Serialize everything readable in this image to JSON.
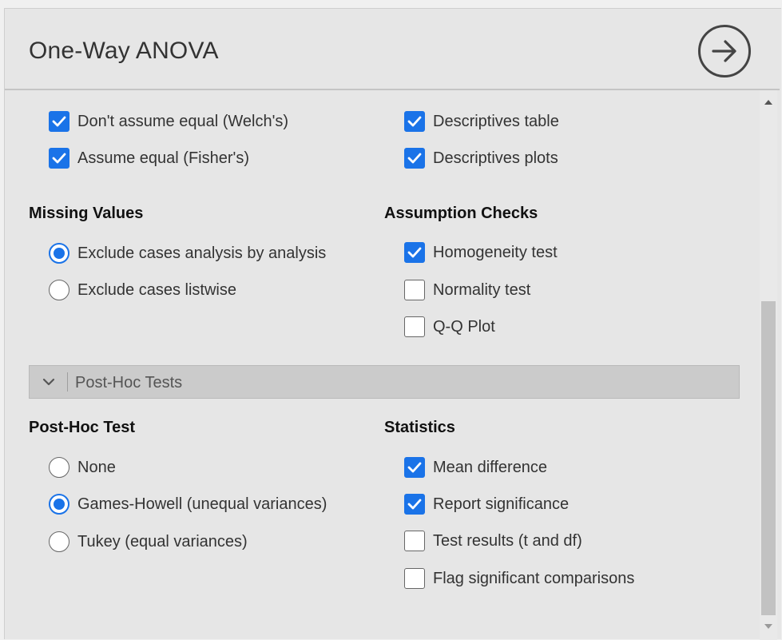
{
  "header": {
    "title": "One-Way ANOVA"
  },
  "variances": {
    "welch": {
      "label": "Don't assume equal (Welch's)",
      "checked": true
    },
    "fisher": {
      "label": "Assume equal (Fisher's)",
      "checked": true
    }
  },
  "additional": {
    "desc_table": {
      "label": "Descriptives table",
      "checked": true
    },
    "desc_plots": {
      "label": "Descriptives plots",
      "checked": true
    }
  },
  "missing": {
    "heading": "Missing Values",
    "options": [
      {
        "label": "Exclude cases analysis by analysis",
        "selected": true
      },
      {
        "label": "Exclude cases listwise",
        "selected": false
      }
    ]
  },
  "assumptions": {
    "heading": "Assumption Checks",
    "options": [
      {
        "label": "Homogeneity test",
        "checked": true
      },
      {
        "label": "Normality test",
        "checked": false
      },
      {
        "label": "Q-Q Plot",
        "checked": false
      }
    ]
  },
  "posthoc_section": {
    "label": "Post-Hoc Tests",
    "expanded": true
  },
  "posthoc": {
    "heading": "Post-Hoc Test",
    "options": [
      {
        "label": "None",
        "selected": false
      },
      {
        "label": "Games-Howell (unequal variances)",
        "selected": true
      },
      {
        "label": "Tukey (equal variances)",
        "selected": false
      }
    ]
  },
  "statistics": {
    "heading": "Statistics",
    "options": [
      {
        "label": "Mean difference",
        "checked": true
      },
      {
        "label": "Report significance",
        "checked": true
      },
      {
        "label": "Test results (t and df)",
        "checked": false
      },
      {
        "label": "Flag significant comparisons",
        "checked": false
      }
    ]
  },
  "colors": {
    "accent": "#1a73e8",
    "panel_bg": "#e6e6e6",
    "section_bar": "#cbcbcb"
  },
  "icons": {
    "run": "arrow-right-circle-icon",
    "collapse": "chevron-down-icon"
  }
}
